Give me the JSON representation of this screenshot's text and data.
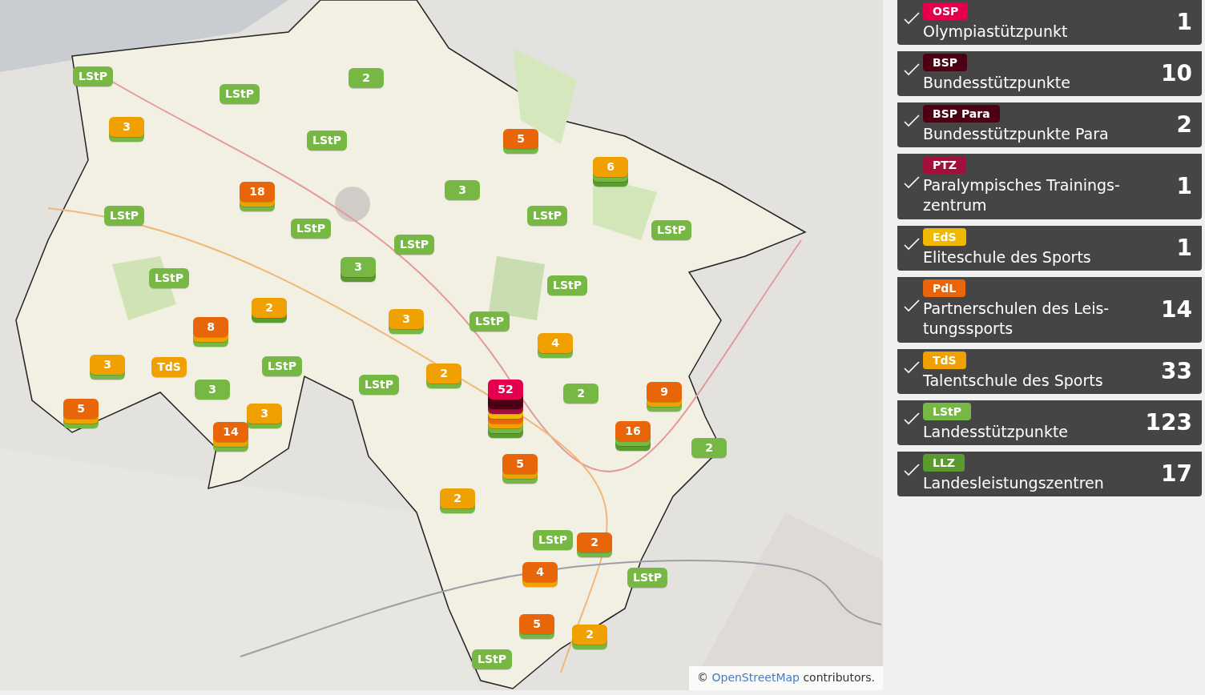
{
  "map": {
    "markers": [
      {
        "label": "LStP",
        "color": "#76b843"
      },
      {
        "label": "LStP",
        "color": "#76b843"
      },
      {
        "label": "2",
        "color": "#76b843"
      },
      {
        "label": "3",
        "color": "#f0a000",
        "layers": [
          {
            "color": "#76b843"
          }
        ]
      },
      {
        "label": "LStP",
        "color": "#76b843"
      },
      {
        "label": "5",
        "color": "#e8650a",
        "layers": [
          {
            "color": "#76b843"
          }
        ]
      },
      {
        "label": "6",
        "color": "#f0a000",
        "layers": [
          {
            "color": "#76b843"
          },
          {
            "color": "#5a9a2e"
          }
        ]
      },
      {
        "label": "18",
        "color": "#e8650a",
        "layers": [
          {
            "color": "#f0a000"
          },
          {
            "color": "#76b843"
          }
        ]
      },
      {
        "label": "3",
        "color": "#76b843"
      },
      {
        "label": "LStP",
        "color": "#76b843"
      },
      {
        "label": "LStP",
        "color": "#76b843"
      },
      {
        "label": "LStP",
        "color": "#76b843"
      },
      {
        "label": "LStP",
        "color": "#76b843"
      },
      {
        "label": "LStP",
        "color": "#76b843"
      },
      {
        "label": "3",
        "color": "#76b843",
        "layers": [
          {
            "color": "#5a9a2e"
          }
        ]
      },
      {
        "label": "LStP",
        "color": "#76b843"
      },
      {
        "label": "LStP",
        "color": "#76b843"
      },
      {
        "label": "2",
        "color": "#f0a000",
        "layers": [
          {
            "color": "#5a9a2e"
          }
        ]
      },
      {
        "label": "8",
        "color": "#e8650a",
        "layers": [
          {
            "color": "#f0a000"
          },
          {
            "color": "#76b843"
          }
        ]
      },
      {
        "label": "3",
        "color": "#f0a000",
        "layers": [
          {
            "color": "#76b843"
          }
        ]
      },
      {
        "label": "LStP",
        "color": "#76b843"
      },
      {
        "label": "4",
        "color": "#f0a000",
        "layers": [
          {
            "color": "#76b843"
          }
        ]
      },
      {
        "label": "3",
        "color": "#f0a000",
        "layers": [
          {
            "color": "#76b843"
          }
        ]
      },
      {
        "label": "TdS",
        "color": "#f0a000"
      },
      {
        "label": "LStP",
        "color": "#76b843"
      },
      {
        "label": "3",
        "color": "#76b843"
      },
      {
        "label": "LStP",
        "color": "#76b843"
      },
      {
        "label": "2",
        "color": "#f0a000",
        "layers": [
          {
            "color": "#76b843"
          }
        ]
      },
      {
        "label": "52",
        "color": "#e5004f",
        "layers": [
          {
            "color": "#4b0014"
          },
          {
            "color": "#4b0014"
          },
          {
            "color": "#a0103a"
          },
          {
            "color": "#f0b800"
          },
          {
            "color": "#e8650a"
          },
          {
            "color": "#f0a000"
          },
          {
            "color": "#76b843"
          },
          {
            "color": "#5a9a2e"
          }
        ]
      },
      {
        "label": "2",
        "color": "#76b843"
      },
      {
        "label": "9",
        "color": "#e8650a",
        "layers": [
          {
            "color": "#f0a000"
          },
          {
            "color": "#76b843"
          }
        ]
      },
      {
        "label": "5",
        "color": "#e8650a",
        "layers": [
          {
            "color": "#f0a000"
          },
          {
            "color": "#76b843"
          }
        ]
      },
      {
        "label": "3",
        "color": "#f0a000",
        "layers": [
          {
            "color": "#76b843"
          }
        ]
      },
      {
        "label": "14",
        "color": "#e8650a",
        "layers": [
          {
            "color": "#f0a000"
          },
          {
            "color": "#76b843"
          }
        ]
      },
      {
        "label": "16",
        "color": "#e8650a",
        "layers": [
          {
            "color": "#76b843"
          },
          {
            "color": "#5a9a2e"
          }
        ]
      },
      {
        "label": "2",
        "color": "#76b843"
      },
      {
        "label": "5",
        "color": "#e8650a",
        "layers": [
          {
            "color": "#f0a000"
          },
          {
            "color": "#76b843"
          }
        ]
      },
      {
        "label": "2",
        "color": "#f0a000",
        "layers": [
          {
            "color": "#76b843"
          }
        ]
      },
      {
        "label": "LStP",
        "color": "#76b843"
      },
      {
        "label": "2",
        "color": "#e8650a",
        "layers": [
          {
            "color": "#76b843"
          }
        ]
      },
      {
        "label": "4",
        "color": "#e8650a",
        "layers": [
          {
            "color": "#f0a000"
          }
        ]
      },
      {
        "label": "LStP",
        "color": "#76b843"
      },
      {
        "label": "5",
        "color": "#e8650a",
        "layers": [
          {
            "color": "#76b843"
          }
        ]
      },
      {
        "label": "2",
        "color": "#f0a000",
        "layers": [
          {
            "color": "#76b843"
          }
        ]
      },
      {
        "label": "LStP",
        "color": "#76b843"
      }
    ],
    "attribution": {
      "prefix": "©",
      "link": "OpenStreetMap",
      "suffix": "contributors."
    }
  },
  "legend": [
    {
      "tag": "OSP",
      "color": "#e5004f",
      "lines": [
        "Olympiastützpunkt"
      ],
      "count": "1",
      "checked": true
    },
    {
      "tag": "BSP",
      "color": "#4b0014",
      "lines": [
        "Bundesstützpunkte"
      ],
      "count": "10",
      "checked": true
    },
    {
      "tag": "BSP Para",
      "color": "#4b0014",
      "lines": [
        "Bundesstützpunkte Para"
      ],
      "count": "2",
      "checked": true
    },
    {
      "tag": "PTZ",
      "color": "#a0103a",
      "lines": [
        "Paralympisches Trainings-",
        "zentrum"
      ],
      "count": "1",
      "checked": true
    },
    {
      "tag": "EdS",
      "color": "#f0b800",
      "lines": [
        "Eliteschule des Sports"
      ],
      "count": "1",
      "checked": true
    },
    {
      "tag": "PdL",
      "color": "#e8650a",
      "lines": [
        "Partnerschulen des Leis-",
        "tungssports"
      ],
      "count": "14",
      "checked": true
    },
    {
      "tag": "TdS",
      "color": "#f0a000",
      "lines": [
        "Talentschule des Sports"
      ],
      "count": "33",
      "checked": true
    },
    {
      "tag": "LStP",
      "color": "#76b843",
      "lines": [
        "Landesstützpunkte"
      ],
      "count": "123",
      "checked": true
    },
    {
      "tag": "LLZ",
      "color": "#5a9a2e",
      "lines": [
        "Landesleistungszentren"
      ],
      "count": "17",
      "checked": true
    }
  ]
}
